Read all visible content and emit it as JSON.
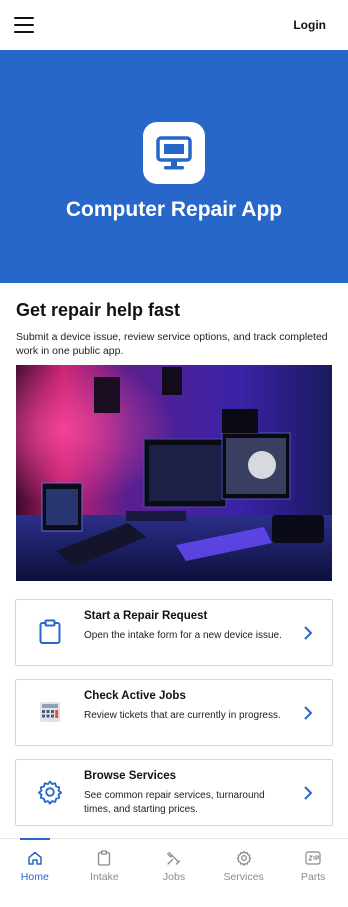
{
  "header": {
    "login_label": "Login"
  },
  "hero": {
    "title": "Computer Repair App",
    "accent": "#2767c9"
  },
  "intro": {
    "heading": "Get repair help fast",
    "body": "Submit a device issue, review service options, and track completed work in one public app."
  },
  "cards": [
    {
      "title": "Start a Repair Request",
      "desc": "Open the intake form for a new device issue.",
      "icon": "clipboard-icon"
    },
    {
      "title": "Check Active Jobs",
      "desc": "Review tickets that are currently in progress.",
      "icon": "calculator-icon"
    },
    {
      "title": "Browse Services",
      "desc": "See common repair services, turnaround times, and starting prices.",
      "icon": "gear-icon"
    }
  ],
  "tabs": [
    {
      "label": "Home",
      "icon": "home-icon",
      "active": true
    },
    {
      "label": "Intake",
      "icon": "clipboard-icon",
      "active": false
    },
    {
      "label": "Jobs",
      "icon": "tools-icon",
      "active": false
    },
    {
      "label": "Services",
      "icon": "gear-icon",
      "active": false
    },
    {
      "label": "Parts",
      "icon": "zip-icon",
      "active": false
    }
  ]
}
